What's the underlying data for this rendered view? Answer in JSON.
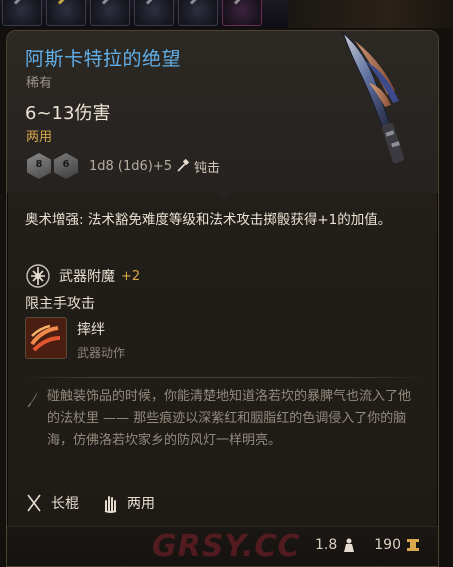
{
  "item": {
    "name": "阿斯卡特拉的绝望",
    "rarity": "稀有",
    "damage": "6~13伤害",
    "handedness": "两用",
    "dice": {
      "die1_label": "8",
      "die2_label": "6",
      "formula": "1d8 (1d6)+5",
      "damage_type": "钝击"
    }
  },
  "effects": {
    "arcane_text": "奥术增强: 法术豁免难度等级和法术攻击掷骰获得+1的加值。",
    "enchant_label": "武器附魔",
    "enchant_bonus": "+2",
    "mainhand": "限主手攻击",
    "action_name": "摔绊",
    "action_sub": "武器动作"
  },
  "lore": "碰触装饰品的时候，你能清楚地知道洛若坎的暴脾气也流入了他的法杖里 —— 那些痕迹以深紫红和胭脂红的色调侵入了你的脑海，仿佛洛若坎家乡的防风灯一样明亮。",
  "properties": [
    {
      "icon": "staff-icon",
      "label": "长棍"
    },
    {
      "icon": "hand-icon",
      "label": "两用"
    }
  ],
  "footer": {
    "watermark": "GRSY.CC",
    "weight": "1.8",
    "value": "190"
  },
  "colors": {
    "title": "#62b0ea",
    "accent": "#d8a84a",
    "muted": "#938a7e"
  }
}
